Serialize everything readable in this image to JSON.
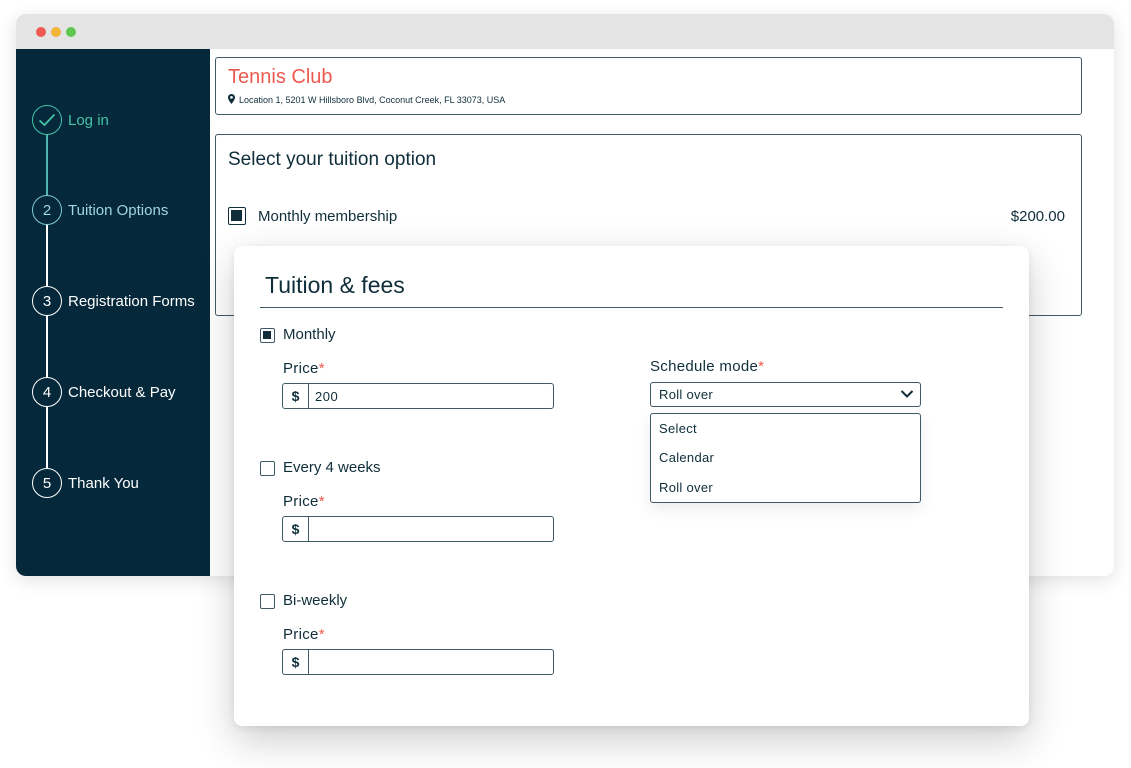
{
  "sidebar": {
    "steps": [
      {
        "number": "",
        "label": "Log in",
        "state": "done"
      },
      {
        "number": "2",
        "label": "Tuition Options",
        "state": "active"
      },
      {
        "number": "3",
        "label": "Registration Forms",
        "state": "pending"
      },
      {
        "number": "4",
        "label": "Checkout & Pay",
        "state": "pending"
      },
      {
        "number": "5",
        "label": "Thank You",
        "state": "pending"
      }
    ]
  },
  "club": {
    "name": "Tennis Club",
    "address": "Location 1, 5201 W Hillsboro Blvd, Coconut Creek, FL 33073, USA"
  },
  "tuition": {
    "heading": "Select your tuition option",
    "option_label": "Monthly membership",
    "option_price": "$200.00"
  },
  "modal": {
    "title": "Tuition & fees",
    "required_mark": "*",
    "price_label": "Price",
    "currency": "$",
    "plans": [
      {
        "label": "Monthly",
        "checked": true,
        "price": "200"
      },
      {
        "label": "Every 4 weeks",
        "checked": false,
        "price": ""
      },
      {
        "label": "Bi-weekly",
        "checked": false,
        "price": ""
      }
    ],
    "schedule": {
      "label": "Schedule mode",
      "selected": "Roll over",
      "options": [
        "Select",
        "Calendar",
        "Roll over"
      ]
    }
  },
  "colors": {
    "sidebar_bg": "#05283a",
    "accent_done": "#45c4a6",
    "club_name": "#ec5a4f",
    "text": "#0f2e3a"
  }
}
